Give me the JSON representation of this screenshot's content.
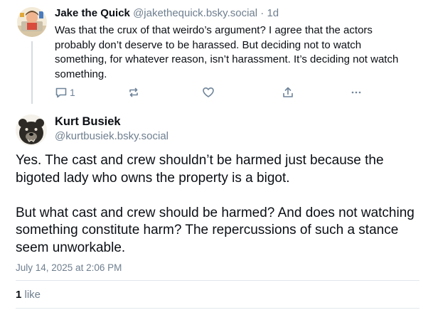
{
  "reply": {
    "author_name": "Jake the Quick",
    "author_handle": "@jakethequick.bsky.social",
    "separator": "·",
    "time_ago": "1d",
    "text": "Was that the crux of that weirdo’s argument? I agree that the actors probably don’t deserve to be harassed. But deciding not to watch something, for whatever reason, isn’t harassment. It’s deciding not watch something.",
    "reply_count": "1"
  },
  "post": {
    "author_name": "Kurt Busiek",
    "author_handle": "@kurtbusiek.bsky.social",
    "paragraphs": [
      "Yes. The cast and crew shouldn’t be harmed just because the bigoted lady who owns the property is a bigot.",
      "But what cast and crew should be harmed? And does not watching something constitute harm? The repercussions of such a stance seem unworkable."
    ],
    "timestamp": "July 14, 2025 at 2:06 PM",
    "like_count": "1",
    "like_label": "like"
  },
  "colors": {
    "action_icon": "#6f849a",
    "muted_text": "#6f7f8f",
    "divider": "#e2e7ec"
  },
  "icons": [
    "reply-icon",
    "repost-icon",
    "like-heart-icon",
    "share-icon",
    "more-icon"
  ]
}
